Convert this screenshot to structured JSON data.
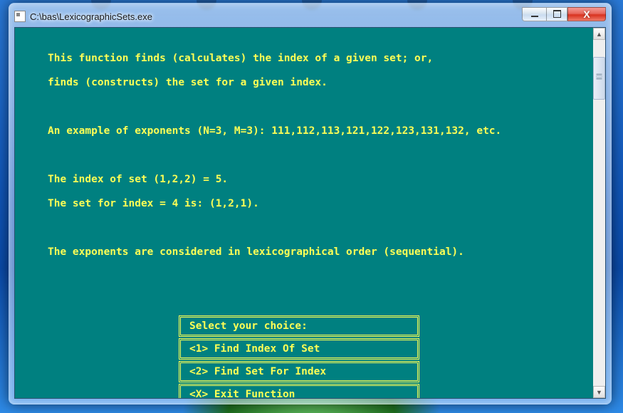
{
  "window": {
    "title": "C:\\bas\\LexicographicSets.exe"
  },
  "description": {
    "line1": "This function finds (calculates) the index of a given set; or,",
    "line2": "finds (constructs) the set for a given index.",
    "example": "An example of exponents (N=3, M=3): 111,112,113,121,122,123,131,132, etc.",
    "indexOfSet": "The index of set (1,2,2) = 5.",
    "setForIndex": "The set for index = 4 is: (1,2,1).",
    "lexOrder": "The exponents are considered in lexicographical order (sequential)."
  },
  "menu": {
    "prompt": "Select your choice:",
    "items": [
      {
        "label": "<1> Find Index Of Set"
      },
      {
        "label": "<2> Find Set For Index"
      },
      {
        "label": "<X> Exit Function"
      }
    ]
  },
  "colors": {
    "consoleBg": "#008080",
    "consoleFg": "#ffff55"
  }
}
